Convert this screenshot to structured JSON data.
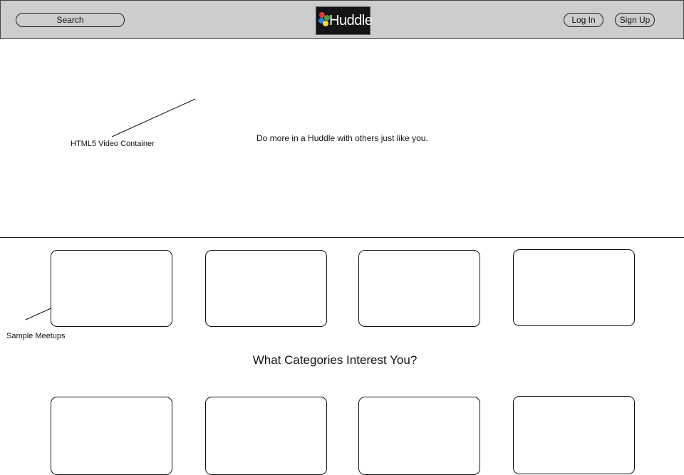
{
  "header": {
    "search_label": "Search",
    "logo_text": "Huddle",
    "login_label": "Log In",
    "signup_label": "Sign Up",
    "logo_dot_colors": [
      "#e53935",
      "#43a047",
      "#1e88e5",
      "#fdd835"
    ]
  },
  "hero": {
    "video_annotation": "HTML5 Video Container",
    "tagline": "Do more in a Huddle with others just like you."
  },
  "meetups": {
    "annotation": "Sample Meetups",
    "cards": [
      "",
      "",
      "",
      ""
    ]
  },
  "categories": {
    "title": "What Categories Interest You?",
    "cards": [
      "",
      "",
      "",
      ""
    ]
  }
}
